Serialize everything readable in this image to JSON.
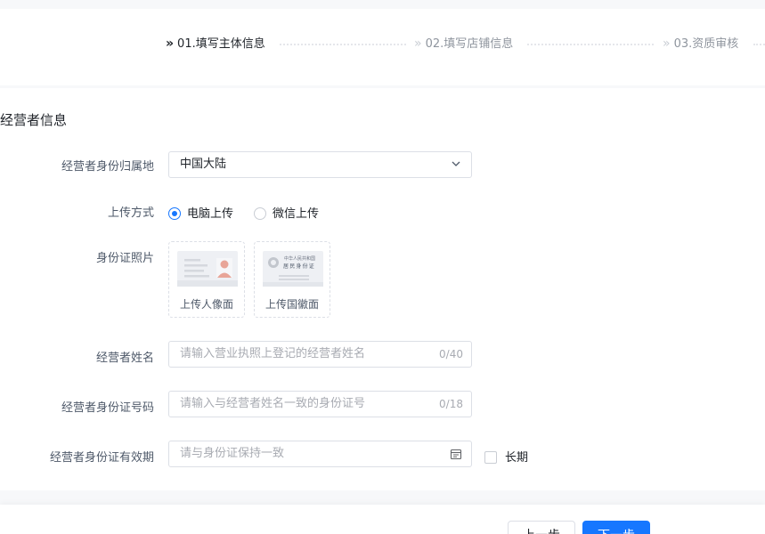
{
  "stepper": {
    "steps": [
      {
        "label": "01.填写主体信息",
        "state": "active"
      },
      {
        "label": "02.填写店铺信息",
        "state": "todo"
      },
      {
        "label": "03.资质审核",
        "state": "todo"
      }
    ],
    "chevron": "»"
  },
  "section": {
    "title": "经营者信息"
  },
  "form": {
    "region": {
      "label": "经营者身份归属地",
      "value": "中国大陆",
      "icon": "chevron-down-icon"
    },
    "upload_method": {
      "label": "上传方式",
      "options": [
        {
          "label": "电脑上传",
          "checked": true
        },
        {
          "label": "微信上传",
          "checked": false
        }
      ]
    },
    "id_photo": {
      "label": "身份证照片",
      "front": {
        "caption": "上传人像面",
        "icon": "id-card-portrait-icon"
      },
      "back": {
        "caption": "上传国徽面",
        "icon": "id-card-emblem-icon",
        "card_title": "中华人民共和国",
        "card_subtitle": "居民身份证"
      }
    },
    "name": {
      "label": "经营者姓名",
      "placeholder": "请输入营业执照上登记的经营者姓名",
      "count": "0/40"
    },
    "id_number": {
      "label": "经营者身份证号码",
      "placeholder": "请输入与经营者姓名一致的身份证号",
      "count": "0/18"
    },
    "id_validity": {
      "label": "经营者身份证有效期",
      "placeholder": "请与身份证保持一致",
      "icon": "calendar-icon",
      "long_term_label": "长期"
    }
  },
  "footer": {
    "prev_label": "上一步",
    "next_label": "下一步"
  },
  "colors": {
    "primary": "#1677ff",
    "border": "#dcdfe6",
    "placeholder": "#a8abb2"
  }
}
